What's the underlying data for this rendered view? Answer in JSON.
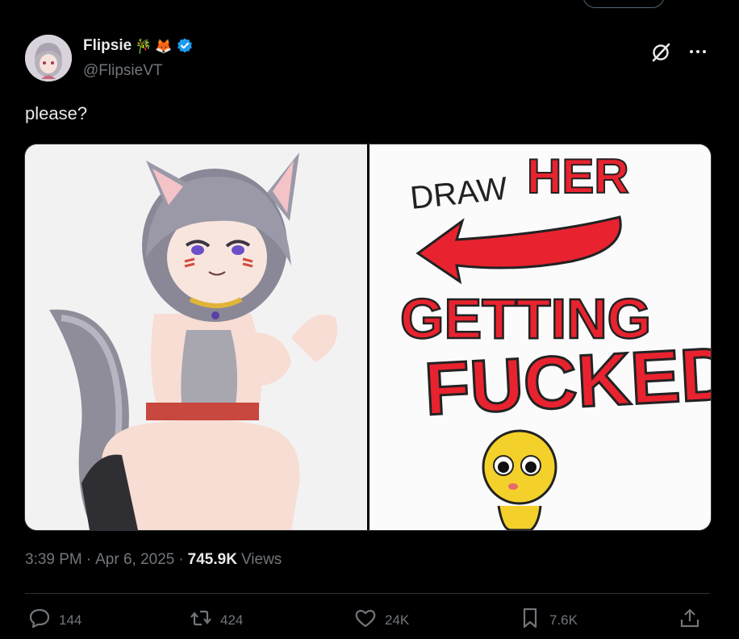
{
  "author": {
    "display_name": "Flipsie",
    "emoji_1": "🎋",
    "emoji_2": "🦊",
    "handle": "@FlipsieVT",
    "verified": true
  },
  "tweet": {
    "text": "please?"
  },
  "media": {
    "right_panel_text": [
      "DRAW",
      "HER",
      "GETTING",
      "FUCKED"
    ]
  },
  "meta": {
    "time": "3:39 PM",
    "separator": "·",
    "date": "Apr 6, 2025",
    "views_count": "745.9K",
    "views_label": "Views"
  },
  "actions": {
    "replies": "144",
    "reposts": "424",
    "likes": "24K",
    "bookmarks": "7.6K"
  },
  "colors": {
    "background": "#000000",
    "text": "#e7e9ea",
    "secondary": "#71767b",
    "verified": "#1d9bf0",
    "meme_red": "#e8232f"
  }
}
